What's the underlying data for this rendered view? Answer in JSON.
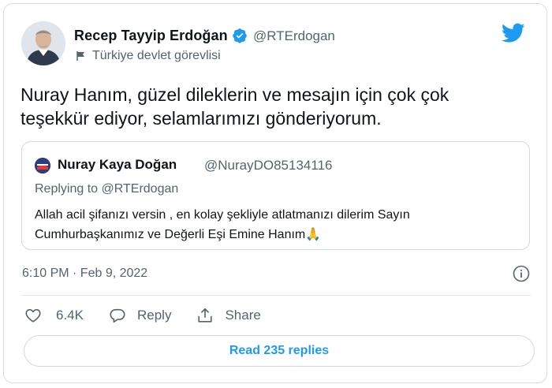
{
  "tweet": {
    "author": {
      "name": "Recep Tayyip Erdoğan",
      "handle": "@RTErdogan",
      "label": "Türkiye devlet görevlisi",
      "verified": true
    },
    "text": "Nuray Hanım, güzel dileklerin ve mesajın için çok çok teşekkür ediyor, selamlarımızı gönderiyorum.",
    "quoted": {
      "name": "Nuray Kaya Doğan",
      "handle": "@NurayDO85134116",
      "replying_prefix": "Replying to",
      "replying_to": "@RTErdogan",
      "text": "Allah acil şifanızı versin , en kolay şekliyle atlatmanızı dilerim Sayın Cumhurbaşkanımız ve Değerli Eşi Emine Hanım🙏"
    },
    "timestamp": "6:10 PM · Feb 9, 2022",
    "actions": {
      "like_count": "6.4K",
      "reply_label": "Reply",
      "share_label": "Share"
    },
    "read_replies": "Read 235 replies"
  },
  "colors": {
    "brand_blue": "#1d9bf0",
    "text_primary": "#0f1419",
    "text_secondary": "#536471",
    "border": "#cfd9de"
  },
  "icons": [
    "twitter-logo-icon",
    "verified-badge-icon",
    "flag-icon",
    "info-icon",
    "heart-icon",
    "reply-icon",
    "share-icon"
  ]
}
